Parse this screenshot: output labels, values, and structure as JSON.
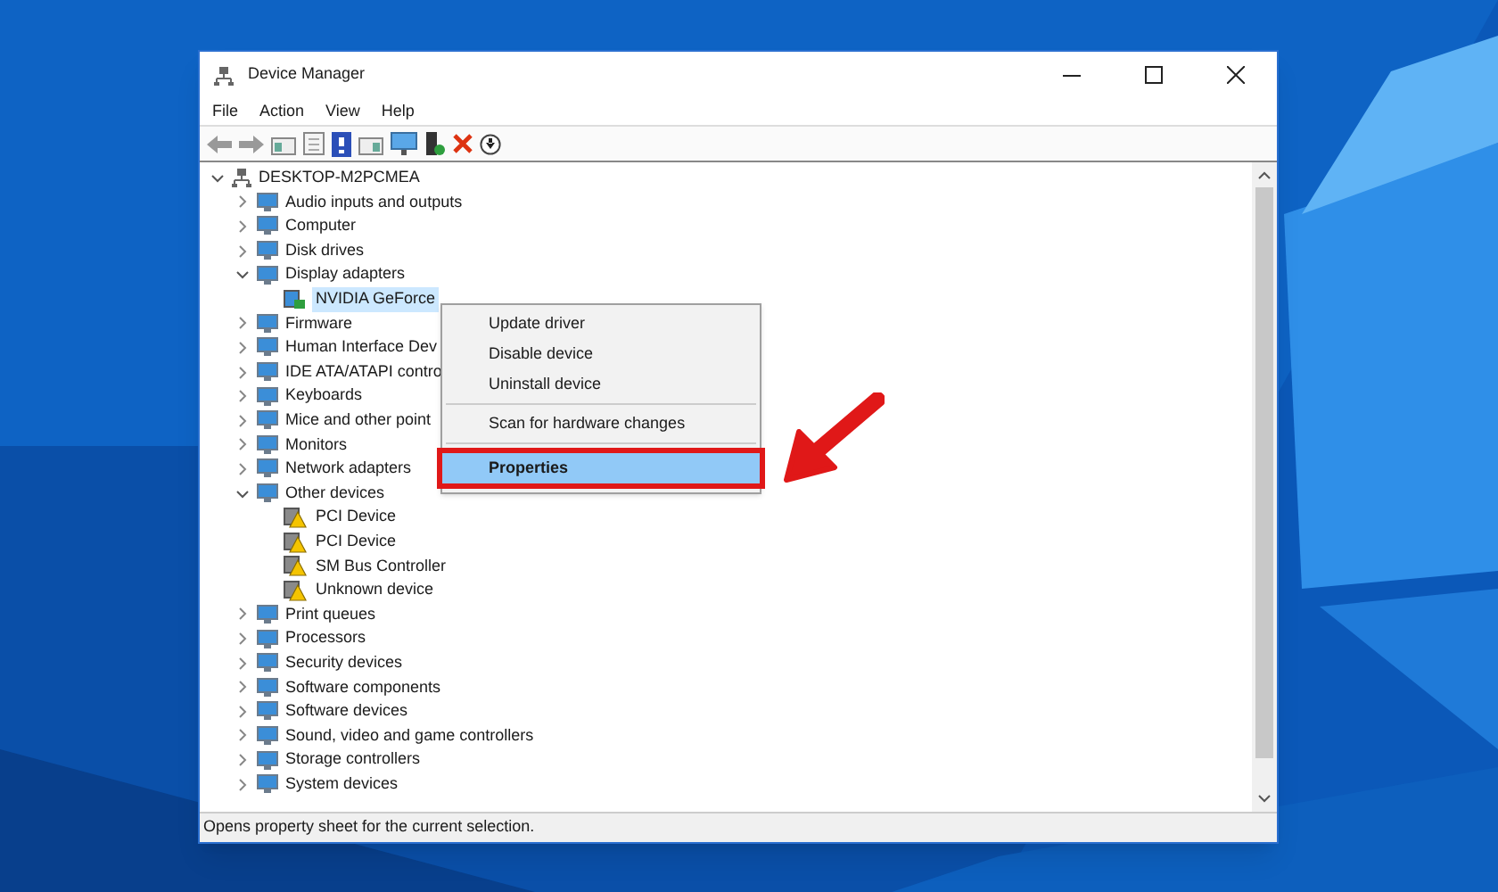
{
  "window": {
    "title": "Device Manager"
  },
  "menu_bar": [
    "File",
    "Action",
    "View",
    "Help"
  ],
  "tree": {
    "label": "DESKTOP-M2PCMEA",
    "expanded": true,
    "children": [
      {
        "label": "Audio inputs and outputs",
        "expanded": false
      },
      {
        "label": "Computer",
        "expanded": false
      },
      {
        "label": "Disk drives",
        "expanded": false
      },
      {
        "label": "Display adapters",
        "expanded": true,
        "children": [
          {
            "label": "NVIDIA GeForce",
            "selected": true,
            "warning": false
          }
        ]
      },
      {
        "label": "Firmware",
        "expanded": false
      },
      {
        "label": "Human Interface Dev",
        "expanded": false
      },
      {
        "label": "IDE ATA/ATAPI contro",
        "expanded": false
      },
      {
        "label": "Keyboards",
        "expanded": false
      },
      {
        "label": "Mice and other point",
        "expanded": false
      },
      {
        "label": "Monitors",
        "expanded": false
      },
      {
        "label": "Network adapters",
        "expanded": false
      },
      {
        "label": "Other devices",
        "expanded": true,
        "children": [
          {
            "label": "PCI Device",
            "selected": false,
            "warning": true
          },
          {
            "label": "PCI Device",
            "selected": false,
            "warning": true
          },
          {
            "label": "SM Bus Controller",
            "selected": false,
            "warning": true
          },
          {
            "label": "Unknown device",
            "selected": false,
            "warning": true
          }
        ]
      },
      {
        "label": "Print queues",
        "expanded": false
      },
      {
        "label": "Processors",
        "expanded": false
      },
      {
        "label": "Security devices",
        "expanded": false
      },
      {
        "label": "Software components",
        "expanded": false
      },
      {
        "label": "Software devices",
        "expanded": false
      },
      {
        "label": "Sound, video and game controllers",
        "expanded": false
      },
      {
        "label": "Storage controllers",
        "expanded": false
      },
      {
        "label": "System devices",
        "expanded": false
      }
    ]
  },
  "context_menu": [
    {
      "label": "Update driver",
      "selected": false,
      "separator_before": false,
      "annotated": false
    },
    {
      "label": "Disable device",
      "selected": false,
      "separator_before": false,
      "annotated": false
    },
    {
      "label": "Uninstall device",
      "selected": false,
      "separator_before": false,
      "annotated": false
    },
    {
      "label": "Scan for hardware changes",
      "selected": false,
      "separator_before": true,
      "annotated": false
    },
    {
      "label": "Properties",
      "selected": true,
      "separator_before": true,
      "annotated": true
    }
  ],
  "status_bar": "Opens property sheet for the current selection."
}
